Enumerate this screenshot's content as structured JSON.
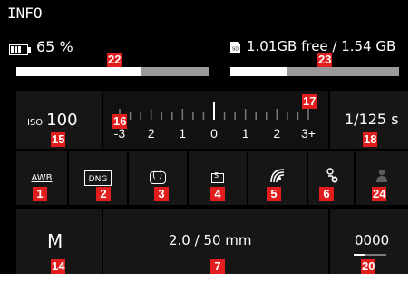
{
  "header": {
    "title": "INFO"
  },
  "status": {
    "battery_percent": "65 %",
    "battery_level": 0.65,
    "sd_icon_label": "SD",
    "storage_free": "1.01GB free / 1.54 GB",
    "storage_used_fraction": 0.34
  },
  "exposure": {
    "iso_prefix": "ISO",
    "iso_value": "100",
    "shutter": "1/125 s",
    "scale": [
      "-3",
      "2",
      "1",
      "0",
      "1",
      "2",
      "3+"
    ]
  },
  "icons": {
    "awb_label": "AWB",
    "dng_label": "DNG",
    "metering_label": "( )",
    "drive_label": "S"
  },
  "bottom": {
    "mode": "M",
    "lens": "2.0 / 50 mm",
    "counter": "0000"
  },
  "callouts": [
    "22",
    "23",
    "17",
    "16",
    "15",
    "18",
    "1",
    "2",
    "3",
    "4",
    "5",
    "6",
    "24",
    "14",
    "7",
    "20"
  ],
  "colors": {
    "marker": "#e11d1d",
    "bar_track": "#9a9a9a",
    "bar_fill": "#ffffff",
    "screen": "#000000"
  }
}
